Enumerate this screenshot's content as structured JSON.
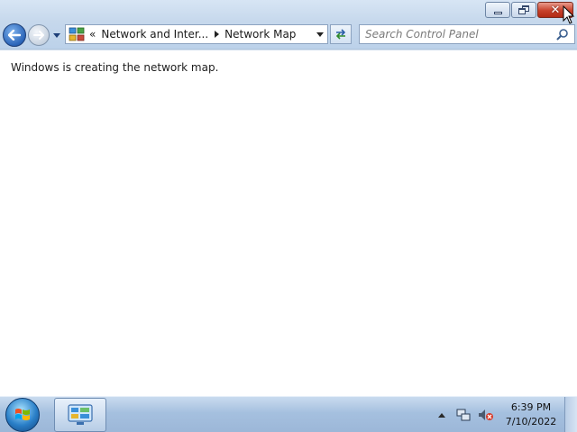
{
  "window": {
    "caption_buttons": {
      "minimize": "minimize-icon",
      "maximize": "restore-icon",
      "close": "close-icon"
    },
    "close_symbol": "✕"
  },
  "navbar": {
    "back": "back-arrow-icon",
    "forward": "forward-arrow-icon",
    "address": {
      "chevron": "«",
      "breadcrumbs": [
        "Network and Inter...",
        "Network Map"
      ]
    },
    "search": {
      "placeholder": "Search Control Panel"
    }
  },
  "content": {
    "status_message": "Windows is creating the network map."
  },
  "taskbar": {
    "start": "windows-start-icon",
    "pinned_app": "control-panel-icon",
    "clock": {
      "time": "6:39 PM",
      "date": "7/10/2022"
    }
  },
  "colors": {
    "accent": "#2a64b8",
    "close_red": "#c8412b",
    "taskbar": "#a5c0df"
  }
}
